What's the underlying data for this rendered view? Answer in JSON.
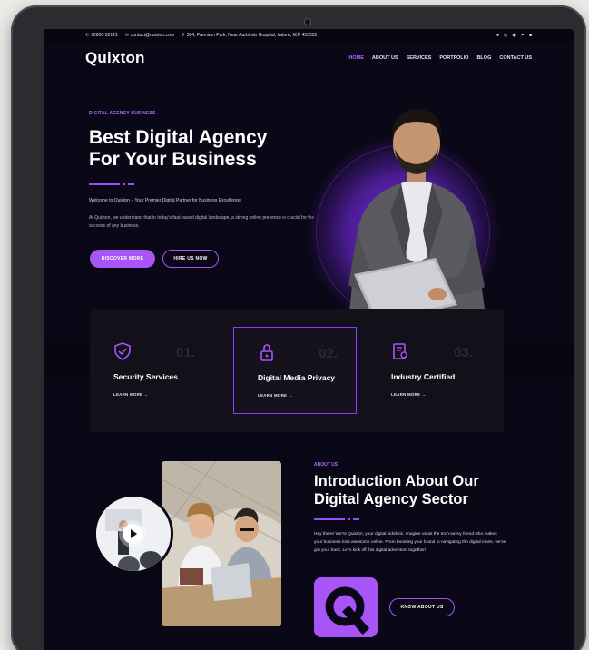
{
  "topbar": {
    "phone": "92830-32121",
    "email": "contact@quixton.com",
    "address": "304, Premium Park, Near Aurbindo Hospital, Indore, M.P 453555",
    "socials": [
      "facebook-icon",
      "instagram-icon",
      "whatsapp-icon",
      "twitter-icon",
      "linkedin-icon"
    ]
  },
  "nav": {
    "logo": "Quixton",
    "items": [
      {
        "label": "HOME",
        "active": true
      },
      {
        "label": "ABOUT US",
        "active": false
      },
      {
        "label": "SERVICES",
        "active": false
      },
      {
        "label": "PORTFOLIO",
        "active": false
      },
      {
        "label": "BLOG",
        "active": false
      },
      {
        "label": "CONTACT US",
        "active": false
      }
    ]
  },
  "hero": {
    "eyebrow": "DIGITAL AGENCY BUSINESS",
    "title_line1": "Best Digital Agency",
    "title_line2": "For Your Business",
    "intro": "Welcome to Quixton – Your Premier Digital Partner for Business Excellence",
    "body": "At Quixton, we understand that in today's fast-paced digital landscape, a strong online presence is crucial for the success of any business.",
    "primary_button": "DISCOVER MORE",
    "secondary_button": "HIRE US NOW"
  },
  "features": [
    {
      "icon": "shield-check-icon",
      "number": "01.",
      "title": "Security Services",
      "link": "LEARN MORE →",
      "highlighted": false
    },
    {
      "icon": "lock-icon",
      "number": "02.",
      "title": "Digital Media Privacy",
      "link": "LEARN MORE →",
      "highlighted": true
    },
    {
      "icon": "certificate-icon",
      "number": "03.",
      "title": "Industry Certified",
      "link": "LEARN MORE →",
      "highlighted": false
    }
  ],
  "about": {
    "eyebrow": "ABOUT US",
    "title_line1": "Introduction About Our",
    "title_line2": "Digital Agency Sector",
    "text": "Hey there! We're Quixton, your digital sidekick. Imagine us as the tech-savvy friend who makes your business look awesome online. From boosting your brand to navigating the digital maze, we've got your back. Let's kick off this digital adventure together!",
    "button": "KNOW ABOUT US"
  },
  "colors": {
    "accent": "#a855f7",
    "background": "#0a0716",
    "card": "#121019"
  }
}
